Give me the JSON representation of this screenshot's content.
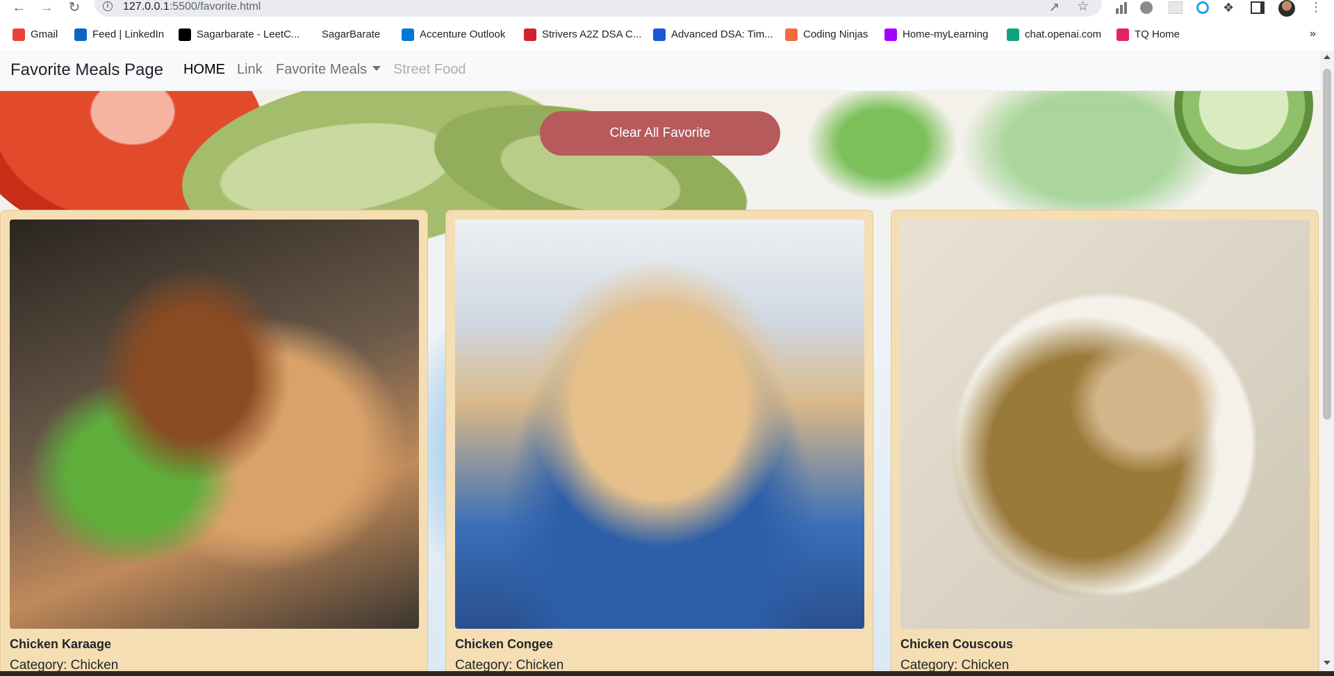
{
  "browser": {
    "url_host": "127.0.0.1",
    "url_rest": ":5500/favorite.html",
    "bookmarks": [
      {
        "label": "Gmail",
        "icon": "gmail-icon",
        "color": "#ea4335"
      },
      {
        "label": "Feed | LinkedIn",
        "icon": "linkedin-icon",
        "color": "#0a66c2"
      },
      {
        "label": "Sagarbarate - LeetC...",
        "icon": "leetcode-icon",
        "color": "#000000"
      },
      {
        "label": "SagarBarate",
        "icon": "",
        "color": ""
      },
      {
        "label": "Accenture Outlook",
        "icon": "outlook-icon",
        "color": "#0078d4"
      },
      {
        "label": "Strivers A2Z DSA C...",
        "icon": "tuf-icon",
        "color": "#d4202c"
      },
      {
        "label": "Advanced DSA: Tim...",
        "icon": "course-icon",
        "color": "#1a56db"
      },
      {
        "label": "Coding Ninjas",
        "icon": "coding-ninjas-icon",
        "color": "#f26b3a"
      },
      {
        "label": "Home-myLearning",
        "icon": "mylearning-icon",
        "color": "#a100ff"
      },
      {
        "label": "chat.openai.com",
        "icon": "openai-icon",
        "color": "#10a37f"
      },
      {
        "label": "TQ Home",
        "icon": "tq-icon",
        "color": "#e0245e"
      }
    ],
    "more": "»"
  },
  "navbar": {
    "brand": "Favorite Meals Page",
    "links": [
      {
        "label": "HOME",
        "state": "active"
      },
      {
        "label": "Link",
        "state": "normal"
      },
      {
        "label": "Favorite Meals",
        "state": "dropdown"
      },
      {
        "label": "Street Food",
        "state": "disabled"
      }
    ]
  },
  "actions": {
    "clear_label": "Clear All Favorite",
    "clear_color": "#b75a5c"
  },
  "cards": [
    {
      "title": "Chicken Karaage",
      "category": "Category: Chicken",
      "image": "chicken-karaage-photo"
    },
    {
      "title": "Chicken Congee",
      "category": "Category: Chicken",
      "image": "chicken-congee-photo"
    },
    {
      "title": "Chicken Couscous",
      "category": "Category: Chicken",
      "image": "chicken-couscous-photo"
    }
  ],
  "colors": {
    "card_bg": "#f5deb3",
    "navbar_bg": "#f8f9fa"
  }
}
